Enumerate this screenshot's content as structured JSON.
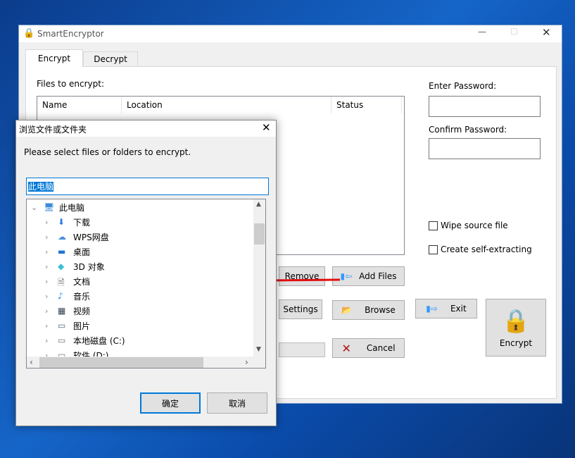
{
  "main_window": {
    "title": "SmartEncryptor",
    "tabs": [
      {
        "label": "Encrypt"
      },
      {
        "label": "Decrypt"
      }
    ],
    "files_label": "Files to encrypt:",
    "columns": [
      "Name",
      "Location",
      "Status"
    ],
    "enter_password_label": "Enter Password:",
    "confirm_password_label": "Confirm Password:",
    "enter_password_value": "",
    "confirm_password_value": "",
    "wipe_source_label": "Wipe source file",
    "self_extracting_label": "Create self-extracting",
    "wipe_source_checked": false,
    "self_extracting_checked": false,
    "buttons": {
      "remove": "Remove",
      "add_files": "Add Files",
      "settings": "Settings",
      "browse": "Browse",
      "exit": "Exit",
      "cancel": "Cancel",
      "encrypt": "Encrypt"
    }
  },
  "dialog": {
    "title": "浏览文件或文件夹",
    "prompt": "Please select files or folders to encrypt.",
    "path_value": "此电脑",
    "tree": [
      {
        "label": "此电脑",
        "icon": "computer-icon",
        "expanded": true
      },
      {
        "label": "下载",
        "icon": "download-icon"
      },
      {
        "label": "WPS网盘",
        "icon": "cloud-icon"
      },
      {
        "label": "桌面",
        "icon": "desktop-icon"
      },
      {
        "label": "3D 对象",
        "icon": "cube-icon"
      },
      {
        "label": "文档",
        "icon": "document-icon"
      },
      {
        "label": "音乐",
        "icon": "music-icon"
      },
      {
        "label": "视频",
        "icon": "video-icon"
      },
      {
        "label": "图片",
        "icon": "picture-icon"
      },
      {
        "label": "本地磁盘 (C:)",
        "icon": "drive-icon"
      },
      {
        "label": "软件 (D:)",
        "icon": "drive-icon"
      }
    ],
    "ok": "确定",
    "cancel": "取消"
  },
  "colors": {
    "accent": "#0078d7",
    "arrow": "#e01010"
  }
}
